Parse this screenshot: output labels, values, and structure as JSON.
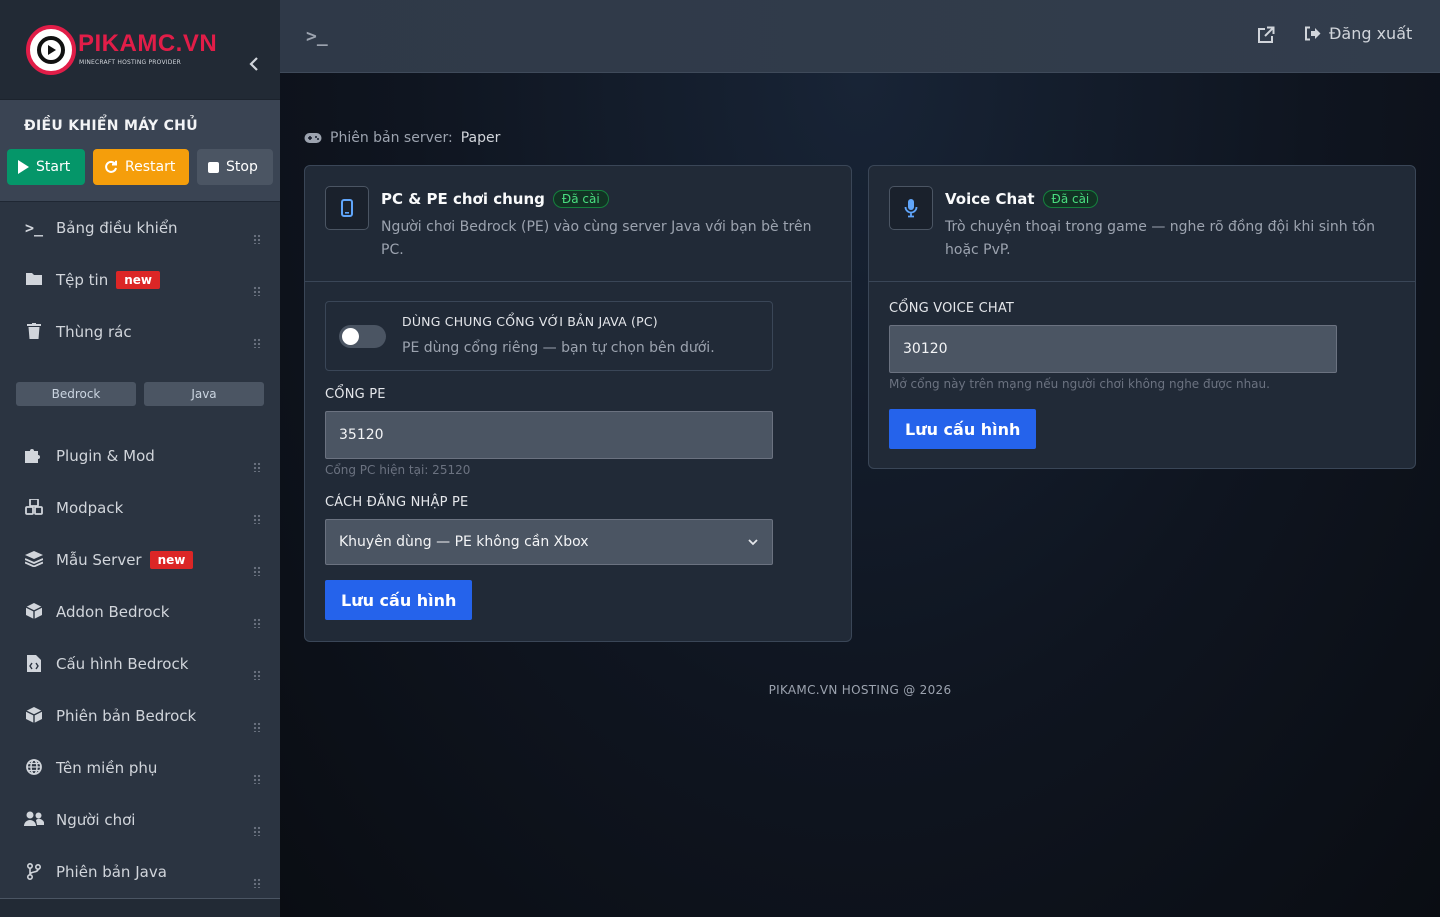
{
  "brand": {
    "name": "PIKAMC.VN",
    "tagline": "MINECRAFT HOSTING PROVIDER",
    "accent": "#e11d48"
  },
  "sidebar": {
    "control_title": "ĐIỀU KHIỂN MÁY CHỦ",
    "buttons": {
      "start": "Start",
      "restart": "Restart",
      "stop": "Stop"
    },
    "items": [
      {
        "label": "Bảng điều khiển",
        "icon": "terminal-icon"
      },
      {
        "label": "Tệp tin",
        "icon": "folder-icon",
        "badge": "new"
      },
      {
        "label": "Thùng rác",
        "icon": "trash-icon"
      },
      {
        "label": "Plugin & Mod",
        "icon": "puzzle-icon"
      },
      {
        "label": "Modpack",
        "icon": "cubes-icon"
      },
      {
        "label": "Mẫu Server",
        "icon": "layers-icon",
        "badge": "new"
      },
      {
        "label": "Addon Bedrock",
        "icon": "cube-icon"
      },
      {
        "label": "Cấu hình Bedrock",
        "icon": "file-code-icon"
      },
      {
        "label": "Phiên bản Bedrock",
        "icon": "cube-icon"
      },
      {
        "label": "Tên miền phụ",
        "icon": "globe-icon"
      },
      {
        "label": "Người chơi",
        "icon": "users-icon"
      },
      {
        "label": "Phiên bản Java",
        "icon": "branch-icon"
      }
    ],
    "mini_tabs": [
      "Bedrock",
      "Java"
    ]
  },
  "topbar": {
    "logout": "Đăng xuất"
  },
  "main": {
    "version_label": "Phiên bản server:",
    "version_value": "Paper",
    "pcpe": {
      "title": "PC & PE chơi chung",
      "status": "Đã cài",
      "desc_line1": "Người chơi Bedrock (PE) vào cùng server Java với bạn bè trên",
      "desc_line2": "PC.",
      "toggle_title": "DÙNG CHUNG CỔNG VỚI BẢN JAVA (PC)",
      "toggle_desc": "PE dùng cổng riêng — bạn tự chọn bên dưới.",
      "port_label": "CỔNG PE",
      "port_value": "35120",
      "port_hint": "Cổng PC hiện tại: 25120",
      "login_label": "CÁCH ĐĂNG NHẬP PE",
      "login_value": "Khuyên dùng — PE không cần Xbox",
      "save": "Lưu cấu hình"
    },
    "voice": {
      "title": "Voice Chat",
      "status": "Đã cài",
      "desc_line1": "Trò chuyện thoại trong game — nghe rõ đồng đội khi sinh tồn",
      "desc_line2": "hoặc PvP.",
      "port_label": "CỔNG VOICE CHAT",
      "port_value": "30120",
      "port_hint": "Mở cổng này trên mạng nếu người chơi không nghe được nhau.",
      "save": "Lưu cấu hình"
    },
    "footer": "PIKAMC.VN HOSTING @ 2026"
  }
}
